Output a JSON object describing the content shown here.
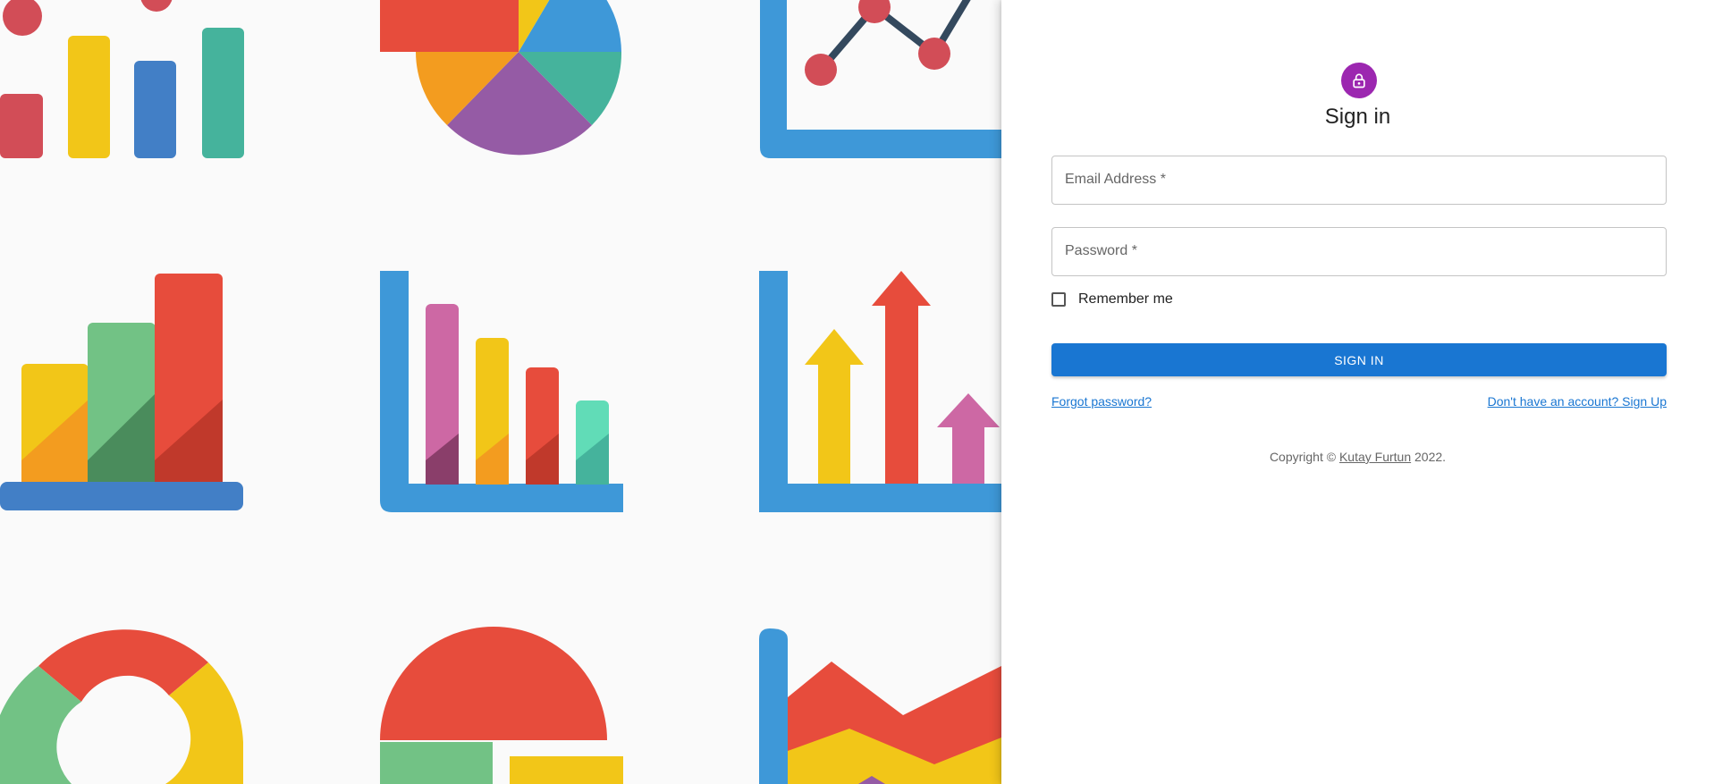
{
  "signin": {
    "title": "Sign in",
    "email_label": "Email Address *",
    "email_value": "",
    "password_label": "Password *",
    "password_value": "",
    "remember_label": "Remember me",
    "remember_checked": false,
    "submit_label": "SIGN IN",
    "forgot_link": "Forgot password?",
    "signup_link": "Don't have an account? Sign Up"
  },
  "footer": {
    "copyright_prefix": "Copyright © ",
    "author": "Kutay Furtun",
    "copyright_suffix": " 2022."
  },
  "icons": {
    "avatar": "lock-icon"
  },
  "colors": {
    "accent": "#1976d2",
    "avatar_bg": "#9c27b0",
    "background": "#fafafa",
    "panel": "#ffffff"
  }
}
